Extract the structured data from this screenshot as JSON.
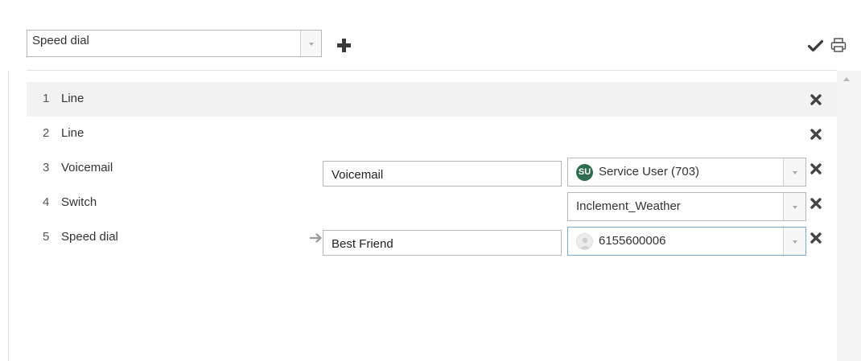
{
  "toolbar": {
    "type_select_value": "Speed dial",
    "add_icon": "plus-icon",
    "confirm_icon": "check-icon",
    "print_icon": "printer-icon"
  },
  "rows": [
    {
      "num": "1",
      "name": "Line",
      "selected": true
    },
    {
      "num": "2",
      "name": "Line"
    },
    {
      "num": "3",
      "name": "Voicemail",
      "label_value": "Voicemail",
      "target_value": "Service User (703)",
      "target_avatar_initials": "SU"
    },
    {
      "num": "4",
      "name": "Switch",
      "target_value": "Inclement_Weather"
    },
    {
      "num": "5",
      "name": "Speed dial",
      "label_value": "Best Friend",
      "target_value": "6155600006"
    }
  ],
  "colors": {
    "selected_row": "#f2f2f2",
    "avatar_green": "#2f6b4e",
    "focus_border": "#7ea7d8"
  }
}
